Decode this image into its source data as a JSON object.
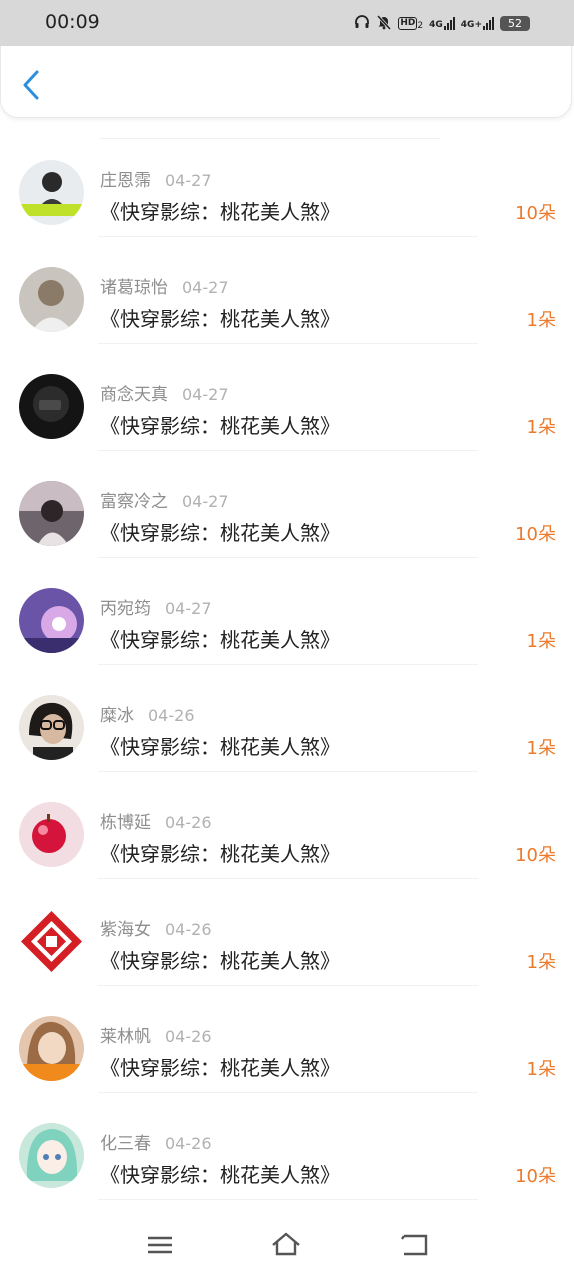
{
  "status_bar": {
    "time": "00:09",
    "icons": [
      "headphones-icon",
      "mute-icon",
      "hd-icon",
      "signal-4g-icon",
      "signal-4g-plus-icon",
      "battery-icon"
    ],
    "hd_label": "HD",
    "hd_sub": "2",
    "net1": "4G",
    "net2": "4G+",
    "battery": "52"
  },
  "header": {
    "back_icon": "chevron-left-icon",
    "accent": "#2c8fe0"
  },
  "list": {
    "items": [
      {
        "name": "庄恩霈",
        "date": "04-27",
        "title": "《快穿影综：桃花美人煞》",
        "amount": "10朵"
      },
      {
        "name": "诸葛琼怡",
        "date": "04-27",
        "title": "《快穿影综：桃花美人煞》",
        "amount": "1朵"
      },
      {
        "name": "商念天真",
        "date": "04-27",
        "title": "《快穿影综：桃花美人煞》",
        "amount": "1朵"
      },
      {
        "name": "富察冷之",
        "date": "04-27",
        "title": "《快穿影综：桃花美人煞》",
        "amount": "10朵"
      },
      {
        "name": "丙宛筠",
        "date": "04-27",
        "title": "《快穿影综：桃花美人煞》",
        "amount": "1朵"
      },
      {
        "name": "糜冰",
        "date": "04-26",
        "title": "《快穿影综：桃花美人煞》",
        "amount": "1朵"
      },
      {
        "name": "栋博延",
        "date": "04-26",
        "title": "《快穿影综：桃花美人煞》",
        "amount": "10朵"
      },
      {
        "name": "紫海女",
        "date": "04-26",
        "title": "《快穿影综：桃花美人煞》",
        "amount": "1朵"
      },
      {
        "name": "莱林帆",
        "date": "04-26",
        "title": "《快穿影综：桃花美人煞》",
        "amount": "1朵"
      },
      {
        "name": "化三春",
        "date": "04-26",
        "title": "《快穿影综：桃花美人煞》",
        "amount": "10朵"
      }
    ],
    "amount_color": "#ec7a2c"
  },
  "nav_bar": {
    "icons": [
      "menu-icon",
      "home-icon",
      "back-icon"
    ]
  }
}
